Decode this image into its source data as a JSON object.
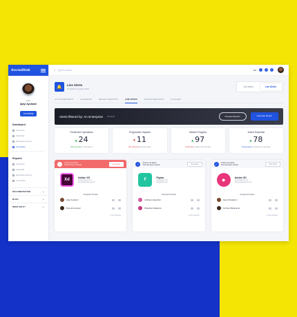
{
  "brand": {
    "name": "Sociallink"
  },
  "profile": {
    "greeting": "Hello",
    "name": "Ajayi Ayobami",
    "button": "Live Alerts"
  },
  "sidebar": {
    "dashboard_title": "Dashboard",
    "dashboard_items": [
      "Overview",
      "Calendar",
      "Schedule Actions",
      "Live Alerts"
    ],
    "reports_title": "Reports",
    "reports_items": [
      "Overview",
      "Calendar",
      "Schedule Actions",
      "Live Alerts"
    ],
    "collapsibles": [
      "DOCUMENTATION",
      "BLOG",
      "NEED HELP?"
    ]
  },
  "topbar": {
    "search_placeholder": "Type to search...",
    "language": "EN"
  },
  "page": {
    "title": "Live Alerts",
    "subtitle": "Sociallink Copyright 2018",
    "toggle": [
      "Live Alerts",
      "Live Alerts"
    ]
  },
  "tabs": [
    "ACTIVE REPORTS",
    "CALENDAR",
    "RECENT REPORTS",
    "LIVE STATS",
    "EXPORT REPORTS",
    "FLAGGED"
  ],
  "banner": {
    "title": "Alerts filtered by: An Enterprise",
    "tag": "Protocol",
    "btn_preview": "Preview Reports",
    "btn_generate": "Generate Report"
  },
  "stats": [
    {
      "title": "Performed Operations",
      "value": "24",
      "note_hl": "25% Increase",
      "note": "in Operations",
      "dir": "up"
    },
    {
      "title": "Progressive Impacts",
      "value": "11",
      "note_hl": "8% lead loss",
      "note": "than last week",
      "dir": "down"
    },
    {
      "title": "Market Progress",
      "value": "97",
      "note_hl": "5.25% less",
      "note": "market than last ago",
      "dir": "up"
    },
    {
      "title": "Active Hotpoints",
      "value": "78",
      "note_hl": "8 new points",
      "note": "compared to yesterday",
      "dir": "up"
    }
  ],
  "cards": [
    {
      "head": "1 New Live Alerts",
      "head2": "This has been viewed",
      "btn": "View Alerts",
      "app": "Adobe XD",
      "meta1": "www.adobexd.com",
      "meta2": "support@adobexd.com",
      "logo": "Xd",
      "logo_color": "#470137",
      "assigned": "Assigned People",
      "people": [
        "Ajayi Ayobami",
        "Dayo Emmanuel"
      ],
      "more": "+ more persons"
    },
    {
      "head": "2 New Live Alerts",
      "head2": "This has been viewed",
      "btn": "View Alerts",
      "app": "Figma",
      "meta1": "www.figma.com",
      "meta2": "info@figma.com",
      "logo": "F",
      "logo_color": "#20c5a0",
      "assigned": "Assigned People",
      "people": [
        "Adebayo Adeyinka",
        "Babatide Oladipupo"
      ],
      "more": "+ more persons"
    },
    {
      "head": "3 New Live Alerts",
      "head2": "This has been viewed",
      "btn": "View Alerts",
      "app": "Adobe XD",
      "meta1": "www.adobexd.com",
      "meta2": "support@adobexd.com",
      "logo": "◆",
      "logo_color": "#e8357a",
      "assigned": "Assigned People",
      "people": [
        "Ajayi Oluwakemi",
        "Kehinde Babatunde"
      ],
      "more": "+ more persons"
    }
  ]
}
